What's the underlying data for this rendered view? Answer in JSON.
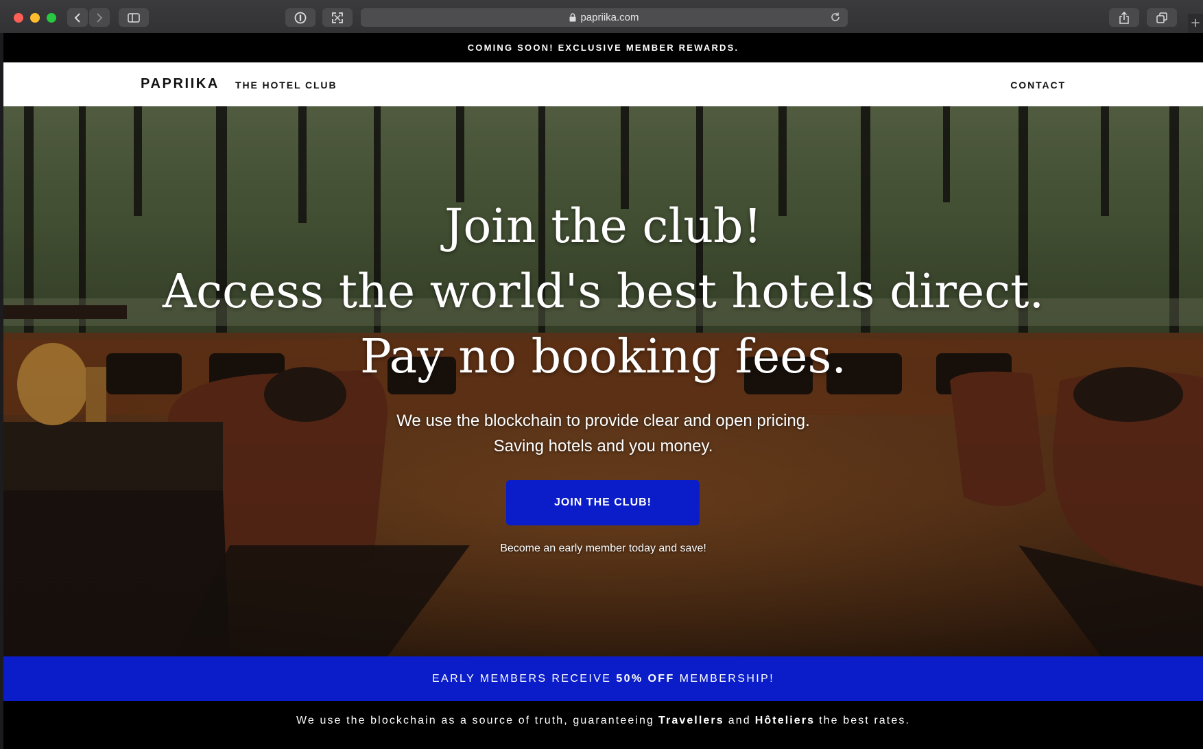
{
  "browser": {
    "url": "papriika.com",
    "icons": {
      "back": "chevron-left-icon",
      "forward": "chevron-right-icon",
      "sidebar": "sidebar-icon",
      "password": "password-manager-icon",
      "fullscreen": "fullscreen-icon",
      "lock": "lock-icon",
      "reload": "reload-icon",
      "share": "share-icon",
      "tabs": "tab-overview-icon",
      "new_tab": "plus-icon"
    }
  },
  "announcement": "COMING SOON! EXCLUSIVE MEMBER REWARDS.",
  "nav": {
    "brand": "PAPRIIKA",
    "tagline": "THE HOTEL CLUB",
    "contact": "CONTACT"
  },
  "hero": {
    "headline": [
      "Join the club!",
      "Access the world's best hotels direct.",
      "Pay no booking fees."
    ],
    "subtext": [
      "We use the blockchain to provide clear and open pricing.",
      "Saving hotels and you money."
    ],
    "cta_label": "JOIN THE CLUB!",
    "note": "Become an early member today and save!"
  },
  "offer_bar": {
    "before": "EARLY MEMBERS RECEIVE",
    "highlight": "50% OFF",
    "after": "MEMBERSHIP!"
  },
  "truth_bar": {
    "part1": "We use the blockchain as a source of truth, guaranteeing",
    "bold1": "Travellers",
    "part2": "and",
    "bold2": "Hôteliers",
    "part3": "the best rates."
  },
  "colors": {
    "accent": "#0b1dc8",
    "nav_bg": "#ffffff",
    "bar_bg": "#000000"
  }
}
